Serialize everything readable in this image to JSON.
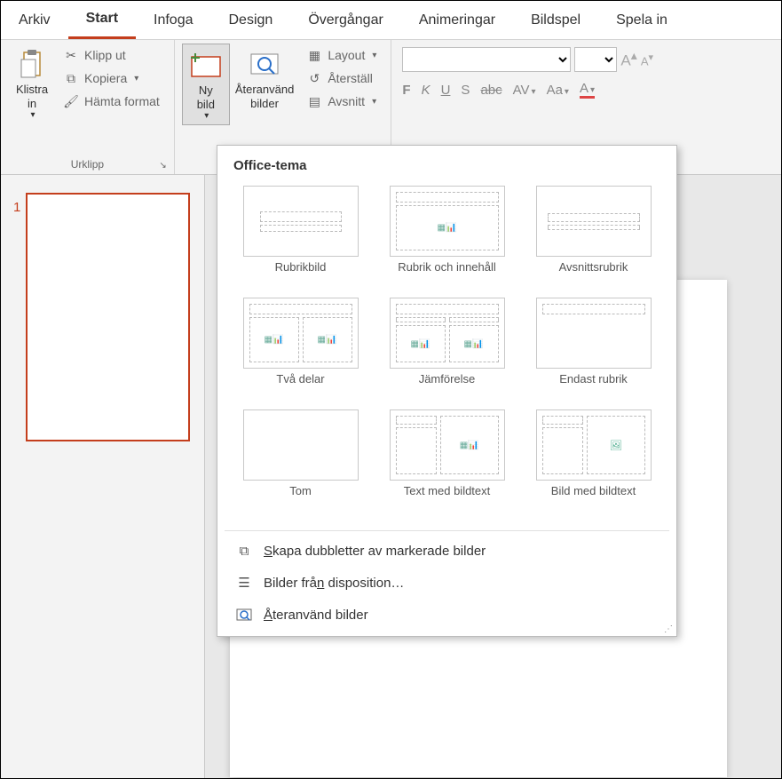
{
  "tabs": {
    "arkiv": "Arkiv",
    "start": "Start",
    "infoga": "Infoga",
    "design": "Design",
    "overgangar": "Övergångar",
    "animeringar": "Animeringar",
    "bildspel": "Bildspel",
    "spela_in": "Spela in"
  },
  "ribbon": {
    "klistra_in": "Klistra\nin",
    "klipp_ut": "Klipp ut",
    "kopiera": "Kopiera",
    "hamta_format": "Hämta format",
    "urklipp": "Urklipp",
    "ny_bild": "Ny\nbild",
    "ateranvand_bilder": "Återanvänd\nbilder",
    "layout": "Layout",
    "aterstall": "Återställ",
    "avsnitt": "Avsnitt",
    "font_b": "F",
    "font_i": "K",
    "font_u": "U",
    "font_s": "S",
    "font_strike": "abc",
    "font_av": "AV",
    "font_aa": "Aa",
    "font_grow": "A",
    "font_shrink": "A"
  },
  "thumb": {
    "num": "1"
  },
  "menu": {
    "title": "Office-tema",
    "layouts": [
      "Rubrikbild",
      "Rubrik och innehåll",
      "Avsnittsrubrik",
      "Två delar",
      "Jämförelse",
      "Endast rubrik",
      "Tom",
      "Text med bildtext",
      "Bild med bildtext"
    ],
    "dup": "kapa dubbletter av markerade bilder",
    "dup_u": "S",
    "outline": "Bilder frå",
    "outline_u": "n",
    "outline_rest": " disposition…",
    "reuse_u": "Å",
    "reuse": "teranvänd bilder"
  }
}
